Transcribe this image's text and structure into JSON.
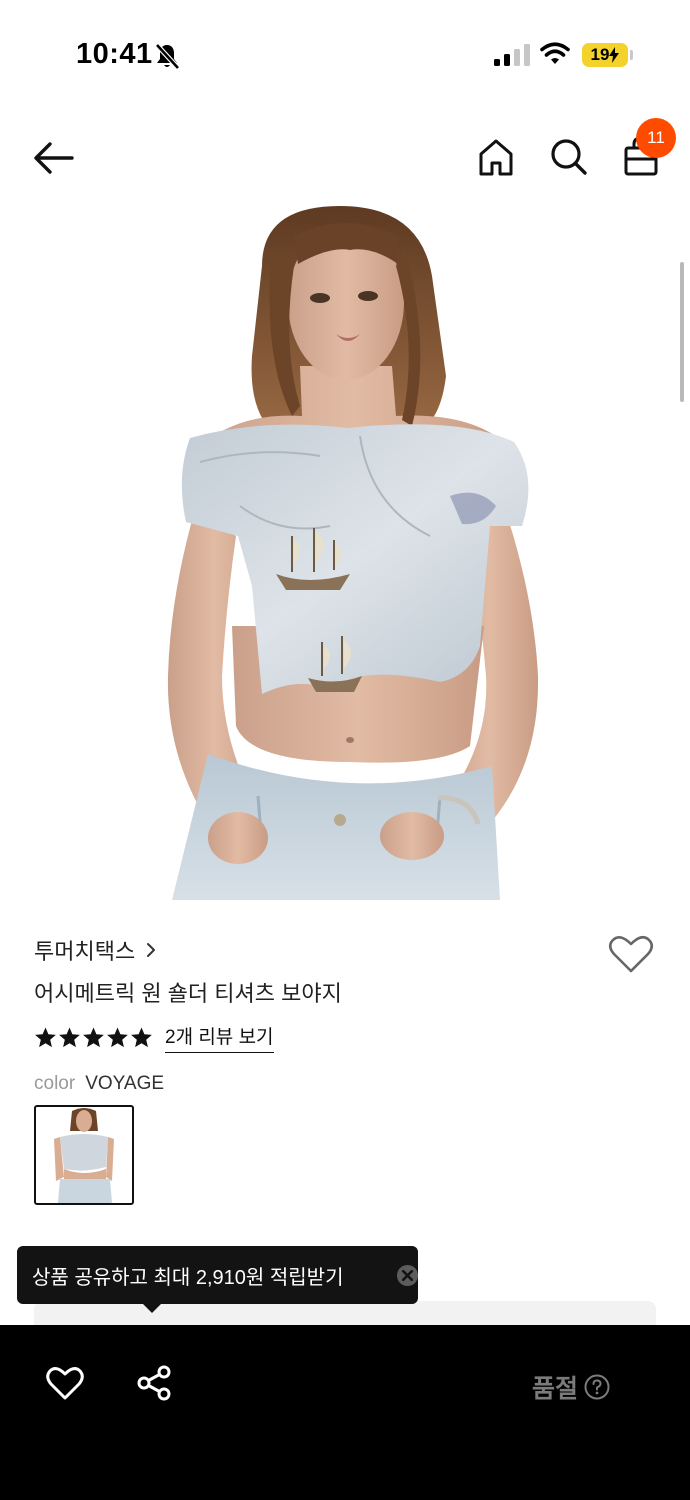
{
  "status_bar": {
    "time": "10:41",
    "battery_level": "19"
  },
  "nav": {
    "cart_count": "11"
  },
  "product": {
    "brand": "투머치택스",
    "title": "어시메트릭 원 숄더 티셔츠 보야지",
    "rating_stars": 5,
    "review_link": "2개 리뷰 보기",
    "color_label": "color",
    "color_value": "VOYAGE"
  },
  "tooltip": {
    "text": "상품 공유하고 최대 2,910원 적립받기"
  },
  "bottom_bar": {
    "status_label": "품절"
  },
  "colors": {
    "accent": "#ff4b00",
    "battery": "#f2d22b",
    "bottom_bar": "#000000",
    "tooltip_bg": "#131313",
    "shirt": "#cfd6dd",
    "jeans": "#c9d6e0",
    "hair": "#7a5030",
    "skin": "#d8ad92"
  },
  "icons": {
    "back": "arrow-left-icon",
    "home": "home-icon",
    "search": "search-icon",
    "bag": "shopping-bag-icon",
    "heart": "heart-outline-icon",
    "share": "share-icon",
    "help": "question-circle-icon",
    "close": "close-circle-icon"
  }
}
